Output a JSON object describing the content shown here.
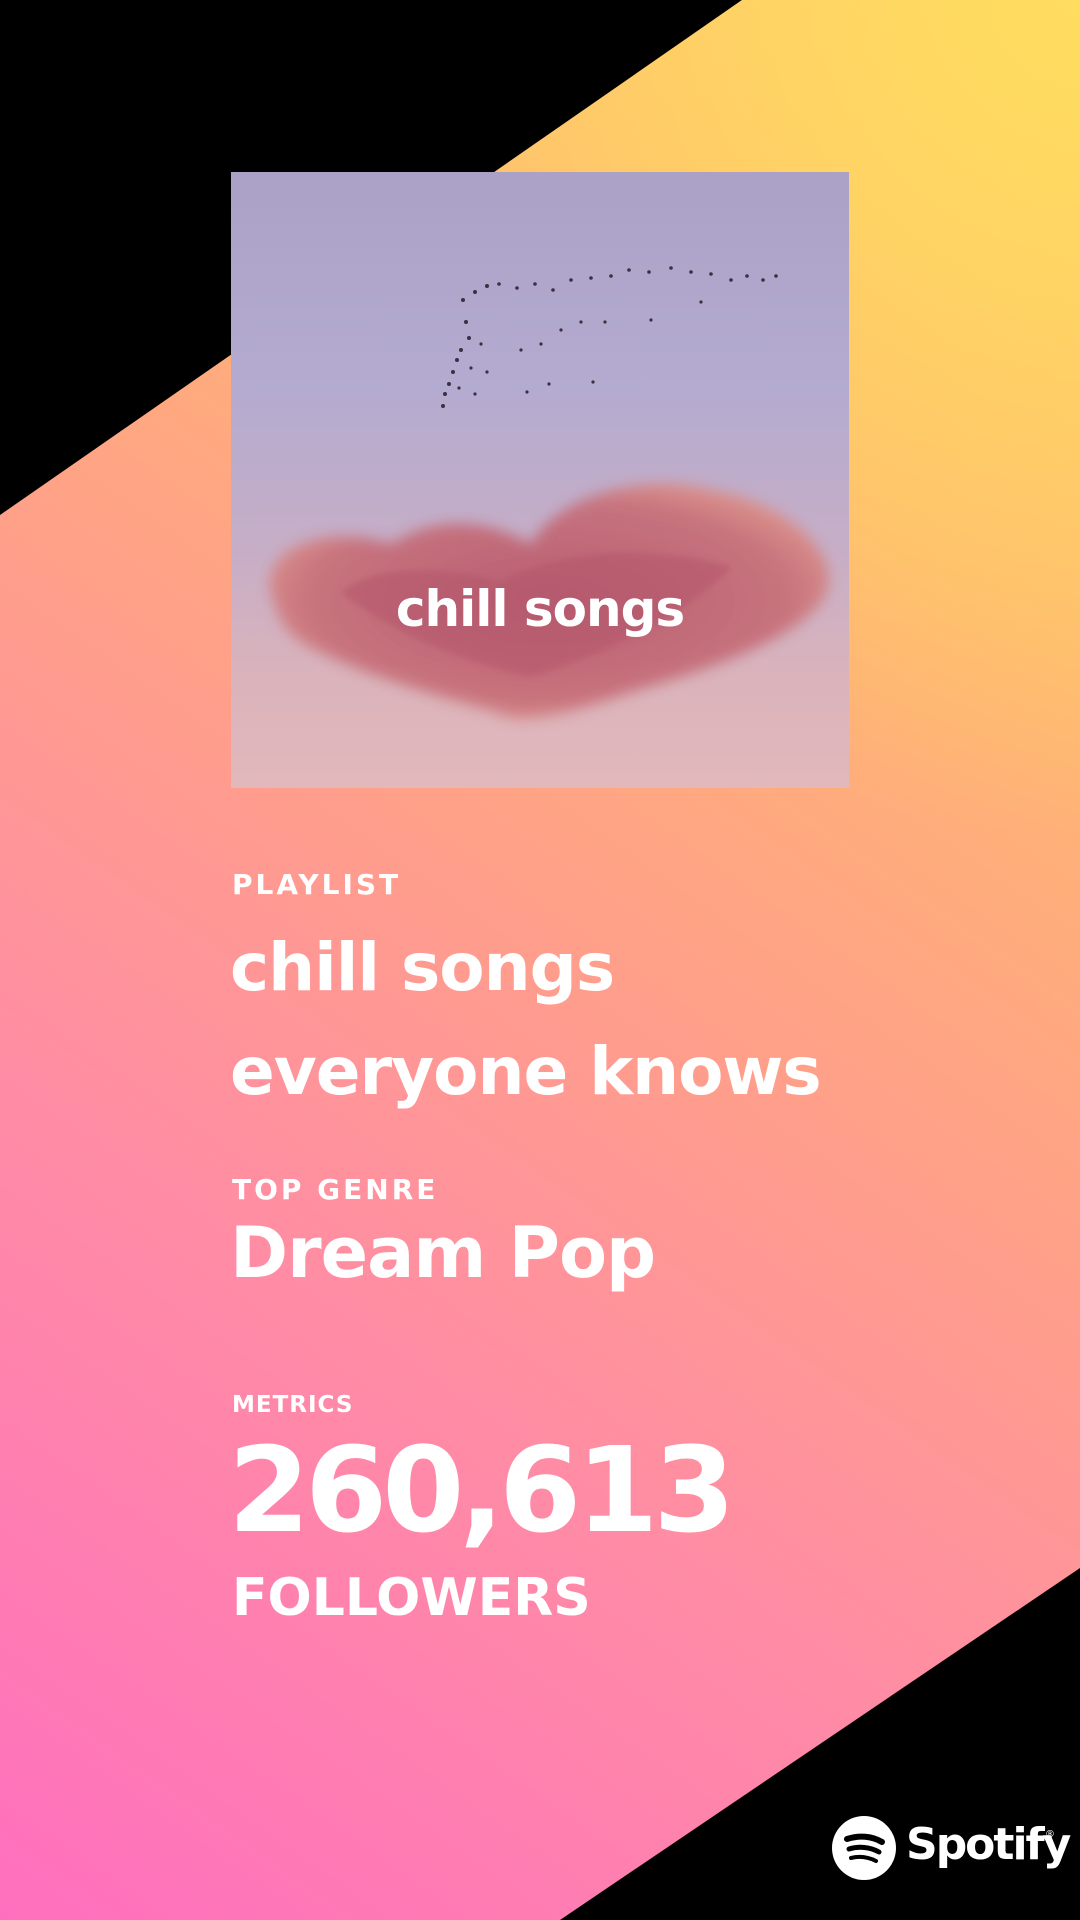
{
  "cover": {
    "title": "chill songs"
  },
  "playlist": {
    "label": "PLAYLIST",
    "name_line1": "chill songs",
    "name_line2": "everyone knows"
  },
  "genre": {
    "label": "TOP GENRE",
    "value": "Dream Pop"
  },
  "metrics": {
    "label": "METRICS",
    "value": "260,613",
    "unit": "FOLLOWERS"
  },
  "brand": {
    "name": "Spotify",
    "mark": "®",
    "icon": "spotify-logo-icon"
  },
  "colors": {
    "background": "#000000",
    "gradient_pink": "#ff6fbe",
    "gradient_peach": "#ffa286",
    "gradient_yellow": "#ffdd5f",
    "text": "#ffffff"
  }
}
